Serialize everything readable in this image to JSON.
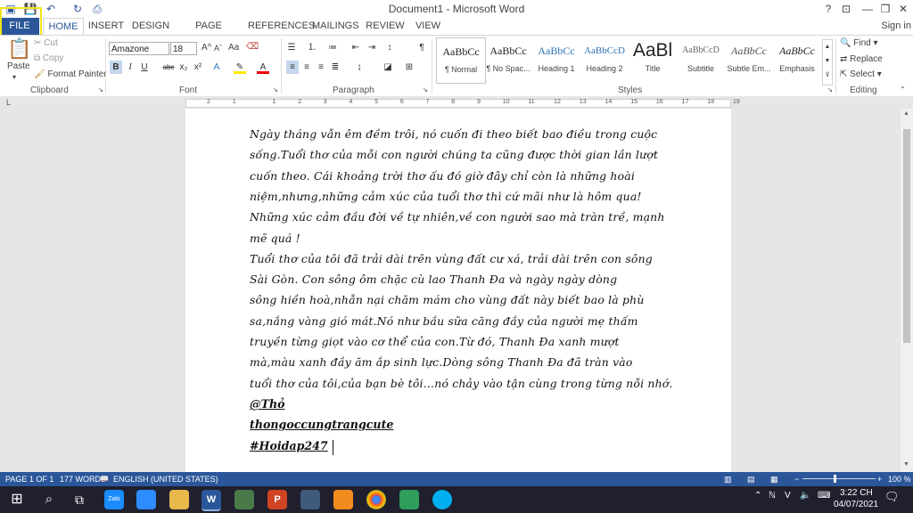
{
  "window": {
    "title": "Document1 - Microsoft Word",
    "help": "?",
    "minimize": "—",
    "restore": "❐",
    "close": "✕",
    "sign_in": "Sign in"
  },
  "tabs": [
    "FILE",
    "HOME",
    "INSERT",
    "DESIGN",
    "PAGE LAYOUT",
    "REFERENCES",
    "MAILINGS",
    "REVIEW",
    "VIEW"
  ],
  "clipboard": {
    "paste": "Paste",
    "cut": "Cut",
    "copy": "Copy",
    "format_painter": "Format Painter",
    "label": "Clipboard"
  },
  "font": {
    "name": "Amazone",
    "size": "18",
    "label": "Font",
    "grow": "A",
    "shrink": "A",
    "case": "Aa",
    "bold": "B",
    "italic": "I",
    "underline": "U",
    "strike": "abc",
    "subscript": "x₂",
    "superscript": "x²"
  },
  "paragraph": {
    "label": "Paragraph",
    "pilcrow": "¶"
  },
  "styles": {
    "label": "Styles",
    "items": [
      {
        "preview": "AaBbCc",
        "name": "¶ Normal"
      },
      {
        "preview": "AaBbCc",
        "name": "¶ No Spac..."
      },
      {
        "preview": "AaBbCc",
        "name": "Heading 1"
      },
      {
        "preview": "AaBbCcD",
        "name": "Heading 2"
      },
      {
        "preview": "AaBl",
        "name": "Title"
      },
      {
        "preview": "AaBbCcD",
        "name": "Subtitle"
      },
      {
        "preview": "AaBbCc",
        "name": "Subtle Em..."
      },
      {
        "preview": "AaBbCc",
        "name": "Emphasis"
      }
    ]
  },
  "editing": {
    "find": "Find",
    "replace": "Replace",
    "select": "Select",
    "label": "Editing"
  },
  "ruler": {
    "ticks": [
      "2",
      "1",
      "1",
      "2",
      "3",
      "4",
      "5",
      "6",
      "7",
      "8",
      "9",
      "10",
      "11",
      "12",
      "13",
      "14",
      "15",
      "16",
      "17",
      "18",
      "19"
    ]
  },
  "document": {
    "lines": [
      "Ngày tháng vẫn êm đềm trôi, nó cuốn đi theo biết bao điều trong cuộc",
      "sống.Tuổi thơ của mỗi con người chúng ta cũng được thời gian lần lượt",
      "cuốn theo. Cái khoảng trời thơ ấu đó giờ đây chỉ còn là những hoài",
      "niệm,nhưng,những cảm xúc của tuổi thơ thì cứ mãi như là hôm qua!",
      "Những xúc cảm đầu đời về tự nhiên,về con người sao mà tràn trề, mạnh",
      "mẽ quá !",
      "Tuổi thơ của tôi đã trải dài trên vùng đất cư xá, trải dài trên con sông",
      "Sài Gòn. Con sông ôm chặc cù lao Thanh Đa và ngày ngày dòng",
      "sông hiền hoà,nhẫn nại chăm mám cho vùng đất này biết bao là phù",
      "sa,nắng vàng gió mát.Nó như bầu sữa căng đầy của người mẹ thấm",
      "truyền từng giọt vào cơ thể của con.Từ đó, Thanh Đa xanh mượt",
      "mà,màu xanh đầy ăm ắp sinh lực.Dòng sông Thanh Đa đã tràn vào",
      "tuổi thơ của tôi,của bạn bè tôi…nó chảy vào tận cùng trong từng nỗi nhớ."
    ],
    "signature": [
      "@Thỏ",
      "thongoccungtrangcute",
      "#Hoidap247"
    ]
  },
  "status": {
    "page": "PAGE 1 OF 1",
    "words": "177 WORDS",
    "language": "ENGLISH (UNITED STATES)",
    "zoom": "100 %"
  },
  "taskbar": {
    "time": "3:22 CH",
    "date": "04/07/2021",
    "lang": "V"
  }
}
